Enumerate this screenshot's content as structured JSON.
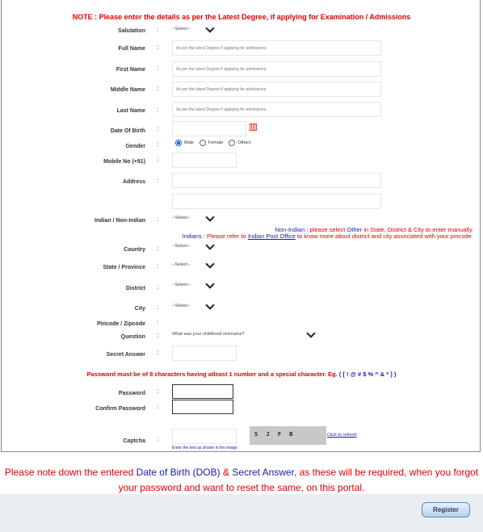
{
  "note": "NOTE : Please enter the details as per the Latest Degree, if applying for Examination / Admissions",
  "labels": {
    "salutation": "Salutation",
    "full_name": "Full Name",
    "first_name": "First Name",
    "middle_name": "Middle Name",
    "last_name": "Last Name",
    "dob": "Date Of Birth",
    "gender": "Gender",
    "mobile": "Mobile No (+91)",
    "address": "Address",
    "indian": "Indian / Non-Indian",
    "country": "Country",
    "state": "State / Province",
    "district": "District",
    "city": "City",
    "pincode": "Pincode / Zipcode",
    "question": "Question",
    "secret_answer": "Secret Answer",
    "password": "Password",
    "confirm_password": "Confirm Password",
    "captcha": "Captcha"
  },
  "colon": ":",
  "select_placeholder": "--Select--",
  "name_placeholder": "As per the latest Degree if applying for admissions",
  "gender_options": [
    "Male",
    "Female",
    "Others"
  ],
  "gender_selected": "Male",
  "question_value": "What was your childhood nickname?",
  "info": {
    "non_indian_prefix": "Non-Indian : ",
    "non_indian_text_1": "please select ",
    "non_indian_other": "Other",
    "non_indian_text_2": " in State, District & City to enter manually.",
    "indians_prefix": "Indians : ",
    "indians_text_1": "Please refer to ",
    "indians_link": "Indian Post Office",
    "indians_text_2": " to know more about district and city associated with your pincode."
  },
  "password_rule": "Password must be of 8 characters having atleast 1 number and a special character. Eg.",
  "password_rule_example": "( [ ! @ # $ % ^ & * ] )",
  "captcha_text": "S J F B",
  "captcha_refresh": "Click to refresh",
  "captcha_hint": "Enter the text as shown in the image",
  "bottom_note": {
    "t1": "Please note down the entered ",
    "dob": "Date of Birth (DOB)",
    "t2": " & ",
    "secret": "Secret Answer",
    "t3": ", as these will be required, when you forgot your password and want to reset the same, on this portal."
  },
  "register_label": "Register",
  "colors": {
    "red": "#e00000",
    "blue": "#1a1ab0",
    "footer": "#e9eef3"
  }
}
